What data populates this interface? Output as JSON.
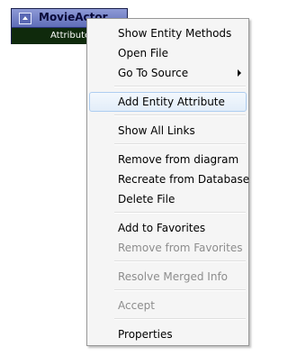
{
  "entity": {
    "title": "MovieActor",
    "attribute_label": "Attribute"
  },
  "menu": {
    "show_entity_methods": "Show Entity Methods",
    "open_file": "Open File",
    "go_to_source": "Go To Source",
    "add_entity_attribute": "Add Entity Attribute",
    "show_all_links": "Show All Links",
    "remove_from_diagram": "Remove from diagram",
    "recreate_from_database": "Recreate from Database",
    "delete_file": "Delete File",
    "add_to_favorites": "Add to Favorites",
    "remove_from_favorites": "Remove from Favorites",
    "resolve_merged_info": "Resolve Merged Info",
    "accept": "Accept",
    "properties": "Properties"
  },
  "icons": {
    "collapse": "collapse-up-icon",
    "submenu": "submenu-arrow-icon"
  },
  "colors": {
    "entity_header": "#6f7cc4",
    "entity_body": "#0f2a0c",
    "menu_background": "#f5f5f5",
    "highlight_border": "#aecdf0",
    "disabled_text": "#8d8d8d"
  }
}
